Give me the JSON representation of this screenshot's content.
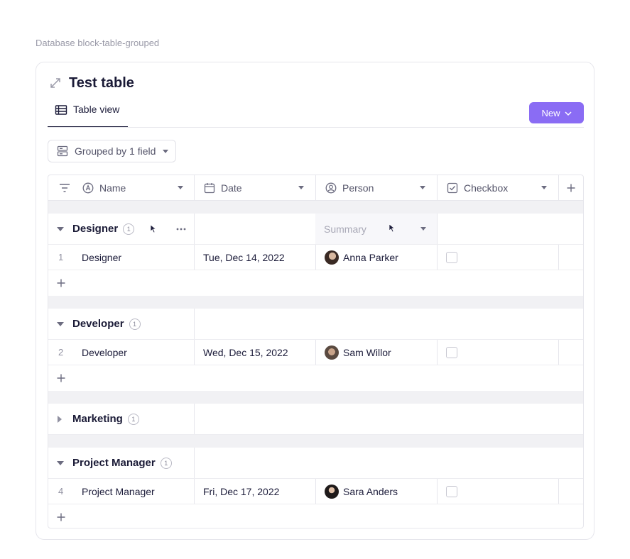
{
  "breadcrumb": "Database block-table-grouped",
  "card": {
    "title": "Test table"
  },
  "tabs": [
    {
      "label": "Table view"
    }
  ],
  "new_button": {
    "label": "New"
  },
  "group_button": {
    "label": "Grouped by 1 field"
  },
  "columns": [
    {
      "label": "Name",
      "icon": "text-property-icon"
    },
    {
      "label": "Date",
      "icon": "calendar-icon"
    },
    {
      "label": "Person",
      "icon": "person-icon"
    },
    {
      "label": "Checkbox",
      "icon": "checkbox-icon"
    }
  ],
  "groups": [
    {
      "name": "Designer",
      "count": "1",
      "expanded": true,
      "summary_label": "Summary",
      "rows": [
        {
          "num": "1",
          "name": "Designer",
          "date": "Tue, Dec 14, 2022",
          "person": "Anna Parker",
          "checked": false
        }
      ]
    },
    {
      "name": "Developer",
      "count": "1",
      "expanded": true,
      "rows": [
        {
          "num": "2",
          "name": "Developer",
          "date": "Wed, Dec 15, 2022",
          "person": "Sam Willor",
          "checked": false
        }
      ]
    },
    {
      "name": "Marketing",
      "count": "1",
      "expanded": false,
      "rows": []
    },
    {
      "name": "Project Manager",
      "count": "1",
      "expanded": true,
      "rows": [
        {
          "num": "4",
          "name": "Project Manager",
          "date": "Fri, Dec 17, 2022",
          "person": "Sara Anders",
          "checked": false
        }
      ]
    }
  ],
  "colors": {
    "accent": "#8a6cf4",
    "border": "#e6e6ec",
    "gap": "#f1f1f4"
  }
}
